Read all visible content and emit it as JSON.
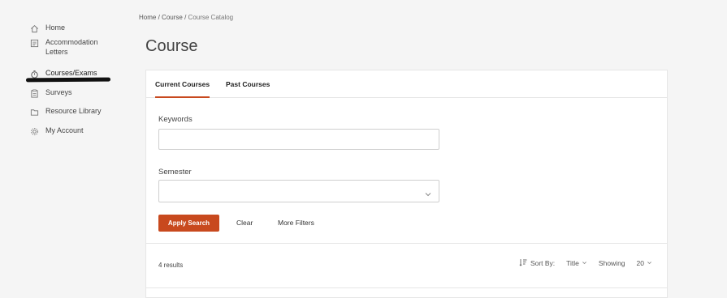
{
  "sidebar": {
    "items": [
      {
        "label": "Home",
        "icon": "home-icon"
      },
      {
        "label": "Accommodation Letters",
        "icon": "letter-icon"
      },
      {
        "label": "Courses/Exams",
        "icon": "stopwatch-icon"
      },
      {
        "label": "Surveys",
        "icon": "clipboard-icon"
      },
      {
        "label": "Resource Library",
        "icon": "folder-icon"
      },
      {
        "label": "My Account",
        "icon": "gear-icon"
      }
    ]
  },
  "breadcrumb": {
    "home": "Home",
    "course": "Course",
    "current": "Course Catalog",
    "sep": "/"
  },
  "page": {
    "title": "Course"
  },
  "tabs": {
    "current": "Current Courses",
    "past": "Past Courses"
  },
  "filters": {
    "keywords_label": "Keywords",
    "keywords_value": "",
    "semester_label": "Semester",
    "semester_value": "",
    "apply": "Apply Search",
    "clear": "Clear",
    "more": "More Filters"
  },
  "results": {
    "count_text": "4 results",
    "sort_label": "Sort By:",
    "sort_value": "Title",
    "showing_label": "Showing",
    "showing_value": "20"
  },
  "colors": {
    "accent": "#c8491e",
    "background": "#f5f5f5",
    "card": "#ffffff"
  }
}
